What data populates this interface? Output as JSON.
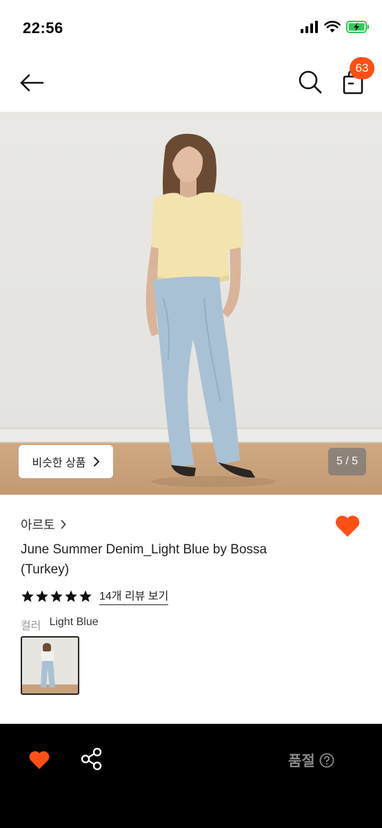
{
  "status_bar": {
    "time": "22:56"
  },
  "nav": {
    "cart_count": "63"
  },
  "hero": {
    "similar_label": "비슷한 상품",
    "page_counter": "5 / 5"
  },
  "product": {
    "brand": "아르토",
    "title": "June Summer Denim_Light Blue by Bossa (Turkey)",
    "rating": 5,
    "review_link": "14개 리뷰 보기",
    "color_label": "컬러",
    "color_value": "Light Blue"
  },
  "bottom_bar": {
    "status": "품절"
  },
  "colors": {
    "accent": "#ff4f14",
    "bottom_bar_bg": "#000000",
    "disabled_text": "#8a8a8a"
  }
}
